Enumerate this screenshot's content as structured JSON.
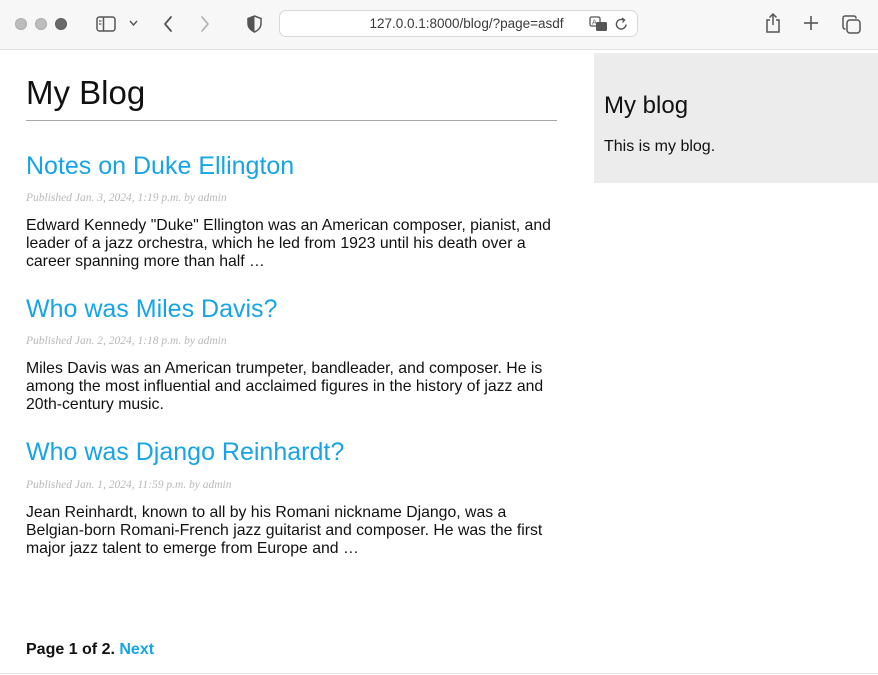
{
  "browser": {
    "url": "127.0.0.1:8000/blog/?page=asdf",
    "icons": [
      "sidebar-toggle-icon",
      "chevron-down-icon",
      "back-icon",
      "forward-icon",
      "shield-icon",
      "translate-icon",
      "reload-icon",
      "share-icon",
      "new-tab-icon",
      "tab-overview-icon"
    ]
  },
  "blog": {
    "title": "My Blog",
    "posts": [
      {
        "title": "Notes on Duke Ellington",
        "meta": "Published Jan. 3, 2024, 1:19 p.m. by admin",
        "excerpt": "Edward Kennedy \"Duke\" Ellington was an American composer, pianist, and leader of a jazz orchestra, which he led from 1923 until his death over a career spanning more than half …"
      },
      {
        "title": "Who was Miles Davis?",
        "meta": "Published Jan. 2, 2024, 1:18 p.m. by admin",
        "excerpt": "Miles Davis was an American trumpeter, bandleader, and composer. He is among the most influential and acclaimed figures in the history of jazz and 20th-century music."
      },
      {
        "title": "Who was Django Reinhardt?",
        "meta": "Published Jan. 1, 2024, 11:59 p.m. by admin",
        "excerpt": "Jean Reinhardt, known to all by his Romani nickname Django, was a Belgian-born Romani-French jazz guitarist and composer. He was the first major jazz talent to emerge from Europe and …"
      }
    ],
    "pagination": {
      "status": "Page 1 of 2.",
      "next_label": "Next"
    }
  },
  "sidebar": {
    "title": "My blog",
    "text": "This is my blog."
  },
  "colors": {
    "link": "#17a4e6",
    "meta": "#b8b8b8",
    "sidebar_bg": "#ececec"
  }
}
